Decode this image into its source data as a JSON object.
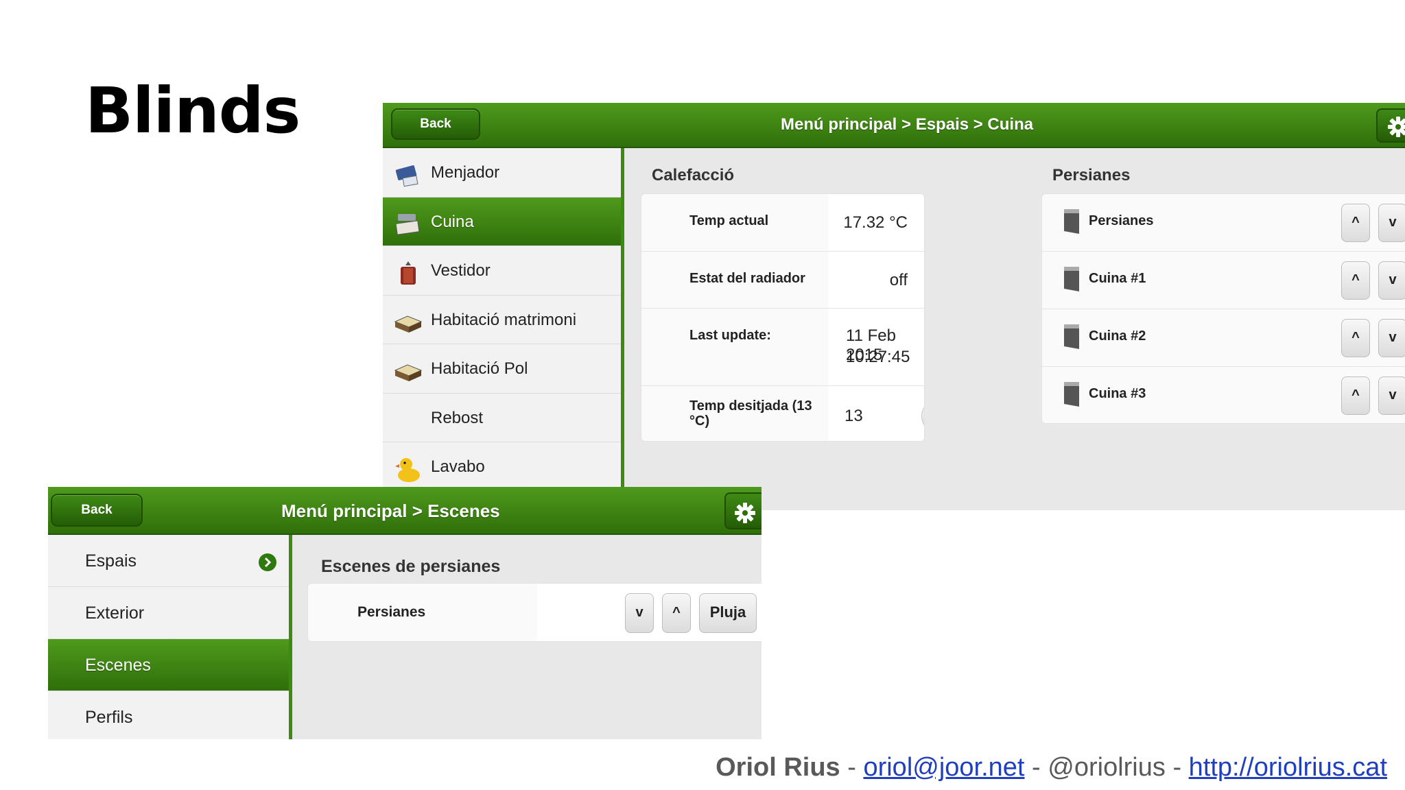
{
  "slide": {
    "title": "Blinds"
  },
  "window1": {
    "back_label": "Back",
    "breadcrumb": "Menú principal > Espais > Cuina",
    "sidebar": [
      {
        "label": "Menjador",
        "icon": "dining-icon",
        "active": false
      },
      {
        "label": "Cuina",
        "icon": "kitchen-icon",
        "active": true
      },
      {
        "label": "Vestidor",
        "icon": "wardrobe-icon",
        "active": false
      },
      {
        "label": "Habitació matrimoni",
        "icon": "bed-icon",
        "active": false
      },
      {
        "label": "Habitació Pol",
        "icon": "bed-icon",
        "active": false
      },
      {
        "label": "Rebost",
        "icon": "",
        "active": false
      },
      {
        "label": "Lavabo",
        "icon": "duck-icon",
        "active": false
      }
    ],
    "heating": {
      "title": "Calefacció",
      "temp_actual_label": "Temp actual",
      "temp_actual_value": "17.32 °C",
      "radiator_label": "Estat del radiador",
      "radiator_value": "off",
      "last_update_label": "Last update:",
      "last_update_date": "11 Feb 2015",
      "last_update_time": "10:27:45",
      "desired_label_1": "Temp desitjada (13",
      "desired_label_2": "°C)",
      "desired_value": "13",
      "minus_label": "-",
      "plus_label": "+"
    },
    "blinds": {
      "title": "Persianes",
      "up_label": "^",
      "down_label": "v",
      "items": [
        "Persianes",
        "Cuina #1",
        "Cuina #2",
        "Cuina #3"
      ]
    }
  },
  "window2": {
    "back_label": "Back",
    "breadcrumb": "Menú principal > Escenes",
    "sidebar": [
      {
        "label": "Espais",
        "active": false,
        "has_arrow": true
      },
      {
        "label": "Exterior",
        "active": false,
        "has_arrow": false
      },
      {
        "label": "Escenes",
        "active": true,
        "has_arrow": false
      },
      {
        "label": "Perfils",
        "active": false,
        "has_arrow": false
      }
    ],
    "scenes": {
      "title": "Escenes de persianes",
      "row_label": "Persianes",
      "down_label": "v",
      "up_label": "^",
      "rain_label": "Pluja"
    }
  },
  "footer": {
    "name": "Oriol Rius",
    "sep1": " - ",
    "email": "oriol@joor.net",
    "sep2": " - @oriolrius - ",
    "url": "http://oriolrius.cat"
  },
  "colors": {
    "accent_green": "#3d8a12",
    "footer_link": "#1f3fbf"
  }
}
